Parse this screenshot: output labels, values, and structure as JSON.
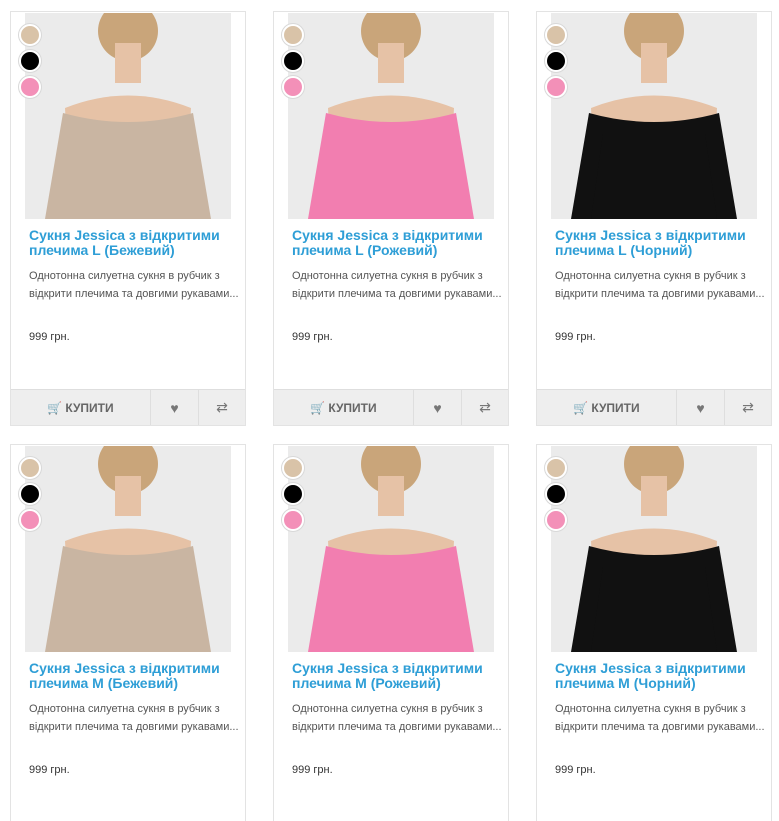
{
  "products": [
    {
      "title": "Сукня Jessica з відкритими плечима L (Бежевий)",
      "desc": "Однотонна силуетна сукня в рубчик з відкрити плечима та довгими рукавами...",
      "price": "999 грн.",
      "dress_color": "#c9b5a2",
      "swatches": [
        "#d9c3a8",
        "#000000",
        "#f390b8"
      ]
    },
    {
      "title": "Сукня Jessica з відкритими плечима L (Рожевий)",
      "desc": "Однотонна силуетна сукня в рубчик з відкрити плечима та довгими рукавами...",
      "price": "999 грн.",
      "dress_color": "#f27eb0",
      "swatches": [
        "#d9c3a8",
        "#000000",
        "#f390b8"
      ]
    },
    {
      "title": "Сукня Jessica з відкритими плечима L (Чорний)",
      "desc": "Однотонна силуетна сукня в рубчик з відкрити плечима та довгими рукавами...",
      "price": "999 грн.",
      "dress_color": "#111111",
      "swatches": [
        "#d9c3a8",
        "#000000",
        "#f390b8"
      ]
    },
    {
      "title": "Сукня Jessica з відкритими плечима M (Бежевий)",
      "desc": "Однотонна силуетна сукня в рубчик з відкрити плечима та довгими рукавами...",
      "price": "999 грн.",
      "dress_color": "#c9b5a2",
      "swatches": [
        "#d9c3a8",
        "#000000",
        "#f390b8"
      ]
    },
    {
      "title": "Сукня Jessica з відкритими плечима M (Рожевий)",
      "desc": "Однотонна силуетна сукня в рубчик з відкрити плечима та довгими рукавами...",
      "price": "999 грн.",
      "dress_color": "#f27eb0",
      "swatches": [
        "#d9c3a8",
        "#000000",
        "#f390b8"
      ]
    },
    {
      "title": "Сукня Jessica з відкритими плечима M (Чорний)",
      "desc": "Однотонна силуетна сукня в рубчик з відкрити плечима та довгими рукавами...",
      "price": "999 грн.",
      "dress_color": "#111111",
      "swatches": [
        "#d9c3a8",
        "#000000",
        "#f390b8"
      ]
    }
  ],
  "actions": {
    "buy_label": "КУПИТИ",
    "buy_icon": "shopping-cart-icon",
    "wishlist_icon": "heart-icon",
    "compare_icon": "compare-arrows-icon"
  },
  "colors": {
    "title_link": "#2e9ed6",
    "action_bar": "#eeeeee"
  }
}
